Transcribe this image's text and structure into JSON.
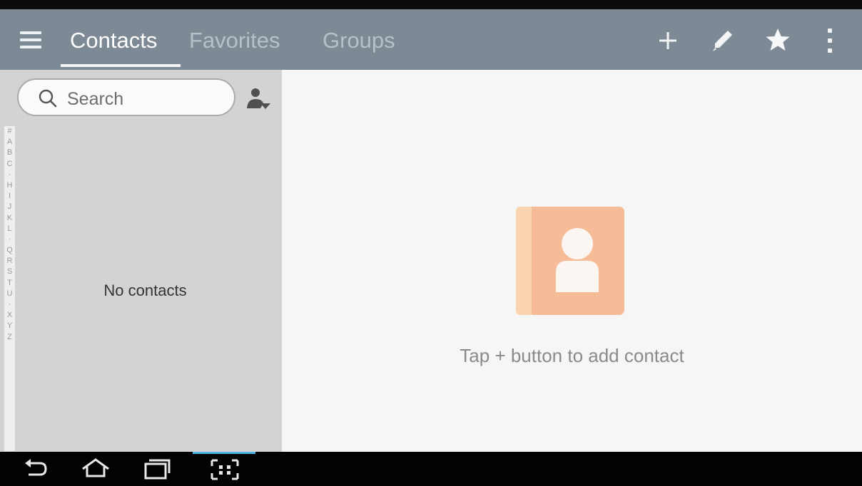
{
  "action_bar": {
    "tabs": [
      {
        "label": "Contacts",
        "active": true
      },
      {
        "label": "Favorites",
        "active": false
      },
      {
        "label": "Groups",
        "active": false
      }
    ],
    "actions": [
      "plus-icon",
      "pencil-icon",
      "star-icon",
      "more-vert-icon"
    ],
    "colors": {
      "background": "#7d8a95",
      "active_text": "#ffffff",
      "inactive_text": "#b6c0c8"
    }
  },
  "left_pane": {
    "search": {
      "placeholder": "Search"
    },
    "index_letters": [
      "#",
      "A",
      "B",
      "C",
      "·",
      "H",
      "I",
      "J",
      "K",
      "L",
      "·",
      "Q",
      "R",
      "S",
      "T",
      "U",
      "·",
      "X",
      "Y",
      "Z"
    ],
    "empty_text": "No contacts"
  },
  "right_pane": {
    "empty_hint": "Tap + button to add contact",
    "icon": "contact-book-icon",
    "colors": {
      "book": "#f6bc98",
      "spine": "#f9d4ae"
    }
  },
  "system_bar": {
    "buttons": [
      "back-icon",
      "home-icon",
      "recents-icon",
      "screen-mirror-icon"
    ]
  }
}
